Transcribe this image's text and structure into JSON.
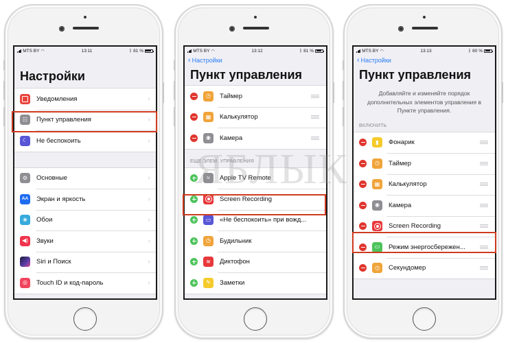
{
  "watermark": "ЯБЛЫК",
  "phones": [
    {
      "status": {
        "carrier": "MTS BY",
        "time": "13:11",
        "battery": "81 %",
        "battery_level": 0.81
      },
      "title": "Настройки",
      "group1": [
        {
          "label": "Уведомления",
          "icon": "notifications-icon"
        },
        {
          "label": "Пункт управления",
          "icon": "control-center-icon",
          "highlighted": true
        },
        {
          "label": "Не беспокоить",
          "icon": "do-not-disturb-moon-icon"
        }
      ],
      "group2": [
        {
          "label": "Основные",
          "icon": "general-gear-icon"
        },
        {
          "label": "Экран и яркость",
          "icon": "display-brightness-icon",
          "glyph": "AA"
        },
        {
          "label": "Обои",
          "icon": "wallpaper-icon",
          "glyph": "❀"
        },
        {
          "label": "Звуки",
          "icon": "sounds-speaker-icon",
          "glyph": "◀)"
        },
        {
          "label": "Siri и Поиск",
          "icon": "siri-icon"
        },
        {
          "label": "Touch ID и код-пароль",
          "icon": "touch-id-icon"
        }
      ]
    },
    {
      "status": {
        "carrier": "MTS BY",
        "time": "13:12",
        "battery": "81 %",
        "battery_level": 0.81
      },
      "back": "Настройки",
      "title": "Пункт управления",
      "included": [
        {
          "label": "Таймер",
          "icon": "timer-icon",
          "glyph": "◷"
        },
        {
          "label": "Калькулятор",
          "icon": "calculator-icon",
          "glyph": "▦"
        },
        {
          "label": "Камера",
          "icon": "camera-icon",
          "glyph": "◉"
        }
      ],
      "more_header": "ЕЩЕ ЭЛЕМ. УПРАВЛЕНИЯ",
      "more": [
        {
          "label": "Apple TV Remote",
          "icon": "apple-tv-icon",
          "glyph": "tv"
        },
        {
          "label": "Screen Recording",
          "icon": "screen-recording-icon",
          "highlighted": true
        },
        {
          "label": "«Не беспокоить» при вожд...",
          "icon": "car-icon",
          "glyph": "▭"
        },
        {
          "label": "Будильник",
          "icon": "alarm-clock-icon",
          "glyph": "◷"
        },
        {
          "label": "Диктофон",
          "icon": "voice-memos-icon",
          "glyph": "≋"
        },
        {
          "label": "Заметки",
          "icon": "notes-icon",
          "glyph": "✎"
        }
      ]
    },
    {
      "status": {
        "carrier": "MTS BY",
        "time": "13:13",
        "battery": "80 %",
        "battery_level": 0.8
      },
      "back": "Настройки",
      "title": "Пункт управления",
      "description": "Добавляйте и изменяйте порядок дополнительных элементов управления в Пункте управления.",
      "include_header": "ВКЛЮЧИТЬ",
      "included": [
        {
          "label": "Фонарик",
          "icon": "flashlight-icon",
          "glyph": "▮"
        },
        {
          "label": "Таймер",
          "icon": "timer-icon",
          "glyph": "◷"
        },
        {
          "label": "Калькулятор",
          "icon": "calculator-icon",
          "glyph": "▦"
        },
        {
          "label": "Камера",
          "icon": "camera-icon",
          "glyph": "◉"
        },
        {
          "label": "Screen Recording",
          "icon": "screen-recording-icon",
          "highlighted": true
        },
        {
          "label": "Режим энергосбережен...",
          "icon": "low-power-battery-icon",
          "glyph": "▭"
        },
        {
          "label": "Секундомер",
          "icon": "stopwatch-icon",
          "glyph": "◷"
        }
      ]
    }
  ]
}
